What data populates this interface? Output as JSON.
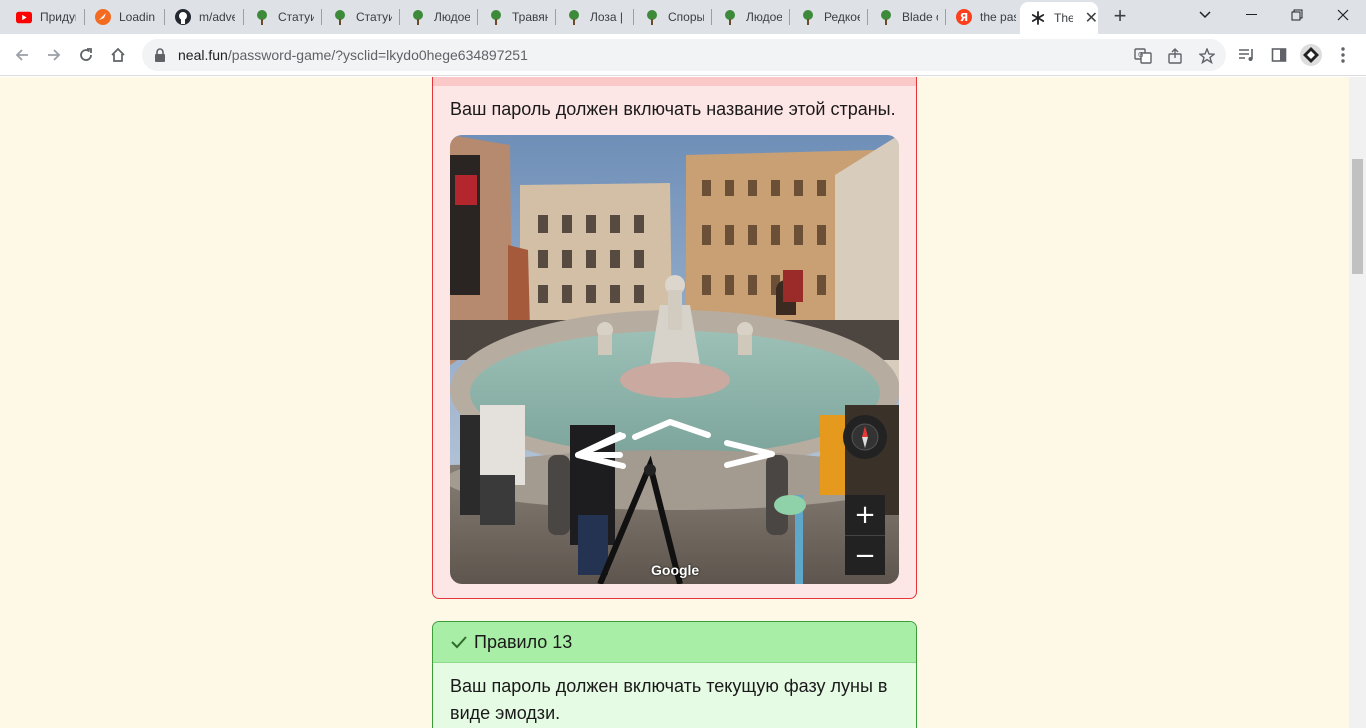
{
  "tabs": [
    {
      "label": "Придумать",
      "icon": "youtube-icon"
    },
    {
      "label": "Loading",
      "icon": "loading-app-icon"
    },
    {
      "label": "m/adventure",
      "icon": "github-icon"
    },
    {
      "label": "Статуи",
      "icon": "plant-icon"
    },
    {
      "label": "Статуи",
      "icon": "plant-icon"
    },
    {
      "label": "Людоед",
      "icon": "plant-icon"
    },
    {
      "label": "Травяной",
      "icon": "plant-icon"
    },
    {
      "label": "Лоза |",
      "icon": "plant-icon"
    },
    {
      "label": "Споры",
      "icon": "plant-icon"
    },
    {
      "label": "Людоед",
      "icon": "plant-icon"
    },
    {
      "label": "Редкое",
      "icon": "plant-icon"
    },
    {
      "label": "Blade o",
      "icon": "plant-icon"
    },
    {
      "label": "the pas",
      "icon": "yandex-icon"
    },
    {
      "label": "The",
      "icon": "asterisk-icon",
      "active": true
    }
  ],
  "address_bar": {
    "domain": "neal.fun",
    "path": "/password-game/?ysclid=lkydo0hege634897251"
  },
  "rule_country": {
    "description": "Ваш пароль должен включать название этой страны.",
    "map_attribution": "Google"
  },
  "rule_13": {
    "title": "Правило 13",
    "description": "Ваш пароль должен включать текущую фазу луны в виде эмодзи."
  },
  "colors": {
    "page_bg": "#fef9e7",
    "fail_border": "#e5343d",
    "fail_bg": "#fde6e6",
    "ok_border": "#3c9c3a",
    "ok_header": "#a9eea6",
    "ok_bg": "#e6fbe4"
  }
}
